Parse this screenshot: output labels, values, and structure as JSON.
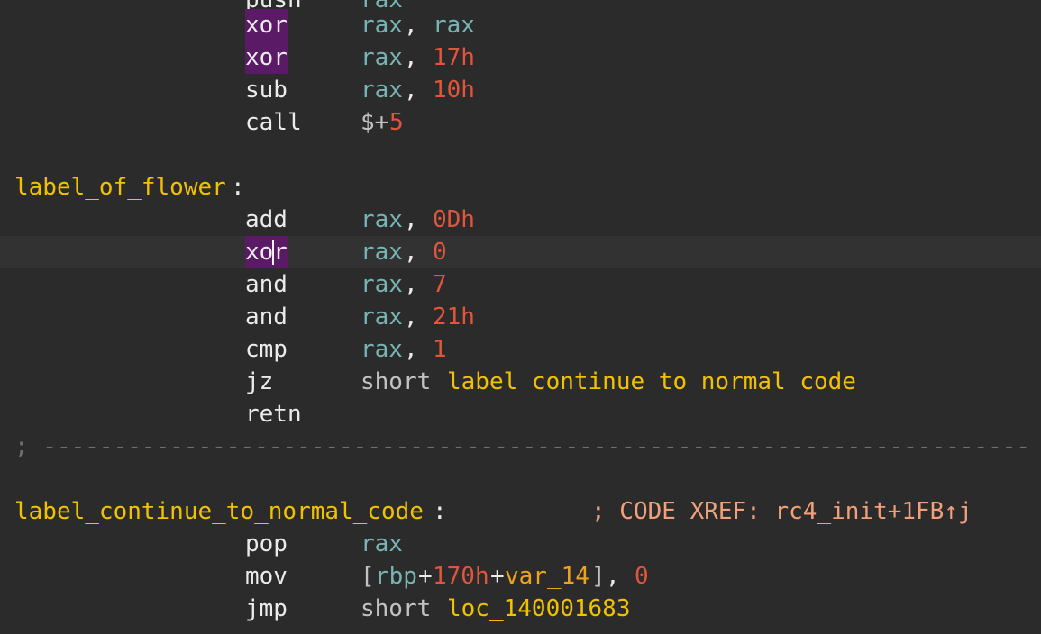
{
  "colors": {
    "background": "#2b2b2b",
    "current_line": "#323232",
    "mnemonic": "#ebebeb",
    "register": "#78b4b4",
    "number": "#e0553b",
    "label": "#f2c200",
    "variable": "#f0a21b",
    "comment": "#f0a07a",
    "highlight": "#5a1a66"
  },
  "lines": {
    "l0": {
      "mnemonic": "push",
      "op": "rax"
    },
    "l1": {
      "mnemonic": "xor",
      "op1": "rax",
      "comma": ", ",
      "op2": "rax"
    },
    "l2": {
      "mnemonic": "xor",
      "op1": "rax",
      "comma": ", ",
      "op2": "17h"
    },
    "l3": {
      "mnemonic": "sub",
      "op1": "rax",
      "comma": ", ",
      "op2": "10h"
    },
    "l4": {
      "mnemonic": "call",
      "op_a": "$+",
      "op_b": "5"
    },
    "l5": {
      "label": "label_of_flower",
      "colon": ":"
    },
    "l6": {
      "mnemonic": "add",
      "op1": "rax",
      "comma": ", ",
      "op2": "0Dh"
    },
    "l7": {
      "mnemonic": "xor",
      "op1": "rax",
      "comma": ", ",
      "op2": "0"
    },
    "l8": {
      "mnemonic": "and",
      "op1": "rax",
      "comma": ", ",
      "op2": "7"
    },
    "l9": {
      "mnemonic": "and",
      "op1": "rax",
      "comma": ", ",
      "op2": "21h"
    },
    "l10": {
      "mnemonic": "cmp",
      "op1": "rax",
      "comma": ", ",
      "op2": "1"
    },
    "l11": {
      "mnemonic": "jz",
      "kw": "short",
      "target": "label_continue_to_normal_code"
    },
    "l12": {
      "mnemonic": "retn"
    },
    "l13": {
      "separator": "; ----------------------------------------------------------------------"
    },
    "l14": {
      "label": "label_continue_to_normal_code",
      "colon": ":",
      "comment": "; CODE XREF: rc4_init+1FB↑j"
    },
    "l15": {
      "mnemonic": "pop",
      "op1": "rax"
    },
    "l16": {
      "mnemonic": "mov",
      "br_open": "[",
      "reg": "rbp",
      "plus1": "+",
      "num": "170h",
      "plus2": "+",
      "var": "var_14",
      "br_close": "]",
      "comma": ", ",
      "op2": "0"
    },
    "l17": {
      "mnemonic": "jmp",
      "kw": "short",
      "target": "loc_140001683"
    }
  }
}
